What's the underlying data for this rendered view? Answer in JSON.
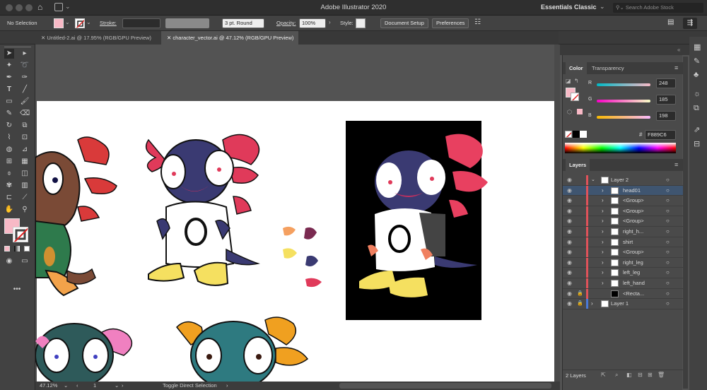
{
  "app_title": "Adobe Illustrator 2020",
  "workspace": "Essentials Classic",
  "search_placeholder": "Search Adobe Stock",
  "control_bar": {
    "selection": "No Selection",
    "stroke_label": "Stroke:",
    "brush": "3 pt. Round",
    "opacity_label": "Opacity:",
    "opacity_value": "100%",
    "style_label": "Style:",
    "document_setup": "Document Setup",
    "preferences": "Preferences"
  },
  "tabs": [
    {
      "label": "Untitled-2.ai @ 17.95% (RGB/GPU Preview)",
      "active": false
    },
    {
      "label": "character_vector.ai @ 47.12% (RGB/GPU Preview)",
      "active": true
    }
  ],
  "color_panel": {
    "tabs": [
      "Color",
      "Transparency"
    ],
    "r": "248",
    "g": "185",
    "b": "198",
    "hex_label": "#",
    "hex": "F889C6",
    "fill_color": "#f8b9c6"
  },
  "layers_panel": {
    "title": "Layers",
    "rows": [
      {
        "name": "Layer 2",
        "level": 0,
        "expanded": true,
        "selected": false
      },
      {
        "name": "head01",
        "level": 1,
        "selected": true
      },
      {
        "name": "<Group>",
        "level": 1,
        "selected": false
      },
      {
        "name": "<Group>",
        "level": 1,
        "selected": false
      },
      {
        "name": "<Group>",
        "level": 1,
        "selected": false
      },
      {
        "name": "right_h...",
        "level": 1,
        "selected": false
      },
      {
        "name": "shirt",
        "level": 1,
        "selected": false
      },
      {
        "name": "<Group>",
        "level": 1,
        "selected": false
      },
      {
        "name": "right_leg",
        "level": 1,
        "selected": false
      },
      {
        "name": "left_leg",
        "level": 1,
        "selected": false
      },
      {
        "name": "left_hand",
        "level": 1,
        "selected": false
      },
      {
        "name": "<Recta...",
        "level": 1,
        "selected": false
      },
      {
        "name": "Layer 1",
        "level": 0,
        "expanded": false,
        "selected": false
      }
    ],
    "count": "2 Layers"
  },
  "status": {
    "zoom": "47.12%",
    "page": "1",
    "tool_hint": "Toggle Direct Selection"
  },
  "colors": {
    "layer2_color": "#e0525a",
    "layer1_color": "#4a7ad8",
    "selection_row": "#3f5570"
  }
}
